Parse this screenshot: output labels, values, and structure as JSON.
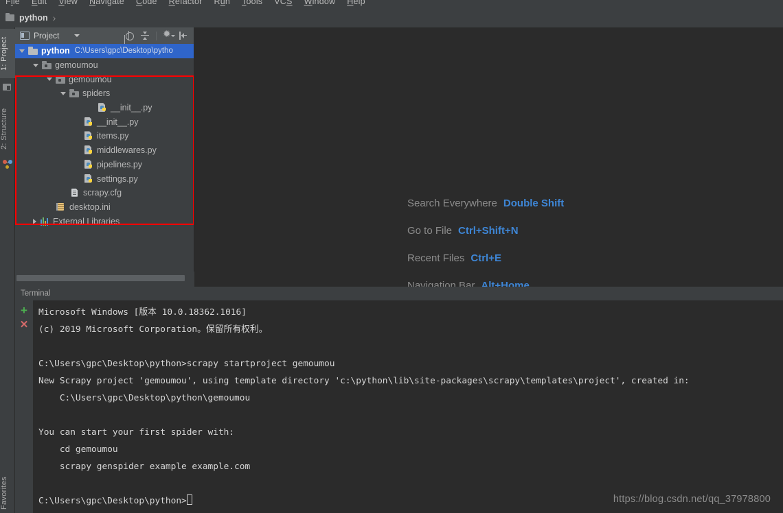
{
  "menubar": {
    "items": [
      {
        "pre": "F",
        "mn": "i",
        "post": "le"
      },
      {
        "pre": "",
        "mn": "E",
        "post": "dit"
      },
      {
        "pre": "",
        "mn": "V",
        "post": "iew"
      },
      {
        "pre": "",
        "mn": "N",
        "post": "avigate"
      },
      {
        "pre": "",
        "mn": "C",
        "post": "ode"
      },
      {
        "pre": "",
        "mn": "R",
        "post": "efactor"
      },
      {
        "pre": "R",
        "mn": "u",
        "post": "n"
      },
      {
        "pre": "",
        "mn": "T",
        "post": "ools"
      },
      {
        "pre": "VC",
        "mn": "S",
        "post": ""
      },
      {
        "pre": "",
        "mn": "W",
        "post": "indow"
      },
      {
        "pre": "",
        "mn": "H",
        "post": "elp"
      }
    ]
  },
  "navbar": {
    "project_name": "python",
    "separator": "›"
  },
  "toolstrip": {
    "project_label": "1: Project",
    "structure_label": "2: Structure",
    "favorites_label": "Favorites"
  },
  "project_panel": {
    "title": "Project",
    "tools": [
      "locate-icon",
      "collapse-all-icon",
      "settings-gear-icon",
      "hide-panel-icon"
    ],
    "tree": [
      {
        "label": "python",
        "path": "C:\\Users\\gpc\\Desktop\\pytho",
        "icon": "folder-icon",
        "indent": 0,
        "arrow": "expanded",
        "selected": true
      },
      {
        "label": "gemoumou",
        "path": "",
        "icon": "folder-icon",
        "indent": 1,
        "arrow": "expanded",
        "selected": false
      },
      {
        "label": "gemoumou",
        "path": "",
        "icon": "folder-icon",
        "indent": 2,
        "arrow": "expanded",
        "selected": false
      },
      {
        "label": "spiders",
        "path": "",
        "icon": "folder-icon",
        "indent": 3,
        "arrow": "expanded",
        "selected": false
      },
      {
        "label": "__init__.py",
        "path": "",
        "icon": "python-file-icon",
        "indent": 5,
        "arrow": "none",
        "selected": false
      },
      {
        "label": "__init__.py",
        "path": "",
        "icon": "python-file-icon",
        "indent": 4,
        "arrow": "none",
        "selected": false
      },
      {
        "label": "items.py",
        "path": "",
        "icon": "python-file-icon",
        "indent": 4,
        "arrow": "none",
        "selected": false
      },
      {
        "label": "middlewares.py",
        "path": "",
        "icon": "python-file-icon",
        "indent": 4,
        "arrow": "none",
        "selected": false
      },
      {
        "label": "pipelines.py",
        "path": "",
        "icon": "python-file-icon",
        "indent": 4,
        "arrow": "none",
        "selected": false
      },
      {
        "label": "settings.py",
        "path": "",
        "icon": "python-file-icon",
        "indent": 4,
        "arrow": "none",
        "selected": false
      },
      {
        "label": "scrapy.cfg",
        "path": "",
        "icon": "config-file-icon",
        "indent": 3,
        "arrow": "none",
        "selected": false
      },
      {
        "label": "desktop.ini",
        "path": "",
        "icon": "ini-file-icon",
        "indent": 2,
        "arrow": "none",
        "selected": false
      },
      {
        "label": "External Libraries",
        "path": "",
        "icon": "library-icon",
        "indent": 1,
        "arrow": "collapsed",
        "selected": false
      }
    ],
    "annotation_color": "#ff0000"
  },
  "editor_hints": [
    {
      "name": "Search Everywhere",
      "key": "Double Shift"
    },
    {
      "name": "Go to File",
      "key": "Ctrl+Shift+N"
    },
    {
      "name": "Recent Files",
      "key": "Ctrl+E"
    },
    {
      "name": "Navigation Bar",
      "key": "Alt+Home"
    }
  ],
  "terminal": {
    "title": "Terminal",
    "new_session_icon": "+",
    "close_session_icon": "✕",
    "lines": [
      "Microsoft Windows [版本 10.0.18362.1016]",
      "(c) 2019 Microsoft Corporation。保留所有权利。",
      "",
      "C:\\Users\\gpc\\Desktop\\python>scrapy startproject gemoumou",
      "New Scrapy project 'gemoumou', using template directory 'c:\\python\\lib\\site-packages\\scrapy\\templates\\project', created in:",
      "    C:\\Users\\gpc\\Desktop\\python\\gemoumou",
      "",
      "You can start your first spider with:",
      "    cd gemoumou",
      "    scrapy genspider example example.com",
      ""
    ],
    "prompt": "C:\\Users\\gpc\\Desktop\\python>"
  },
  "watermark": "https://blog.csdn.net/qq_37978800"
}
